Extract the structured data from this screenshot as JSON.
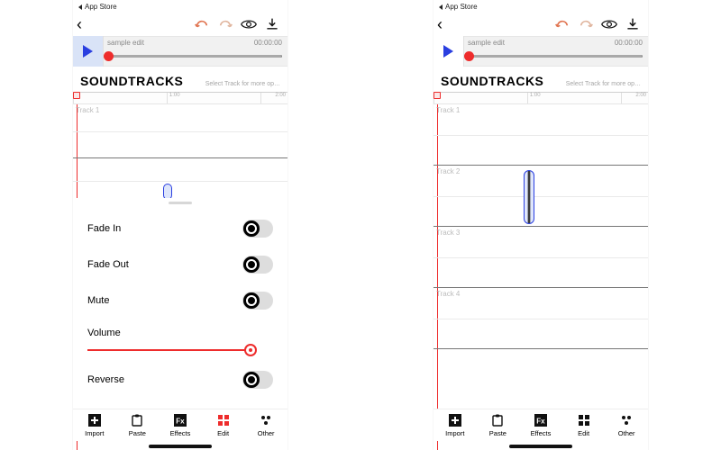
{
  "status": {
    "back_to_app": "App Store"
  },
  "toolbar": {
    "undo": "undo",
    "redo": "redo",
    "preview": "preview",
    "download": "download"
  },
  "transport": {
    "title": "sample edit",
    "time": "00:00:00"
  },
  "section": {
    "title": "SOUNDTRACKS",
    "hint": "Select Track for more op…"
  },
  "ruler": {
    "marks": [
      "",
      "1:00",
      "2:00"
    ]
  },
  "tracks": {
    "t1": "Track 1",
    "t2": "Track 2",
    "t3": "Track 3",
    "t4": "Track 4"
  },
  "sheet": {
    "fade_in": "Fade In",
    "fade_out": "Fade Out",
    "mute": "Mute",
    "volume": "Volume",
    "reverse": "Reverse"
  },
  "tabs": {
    "import": "Import",
    "paste": "Paste",
    "effects": "Effects",
    "edit": "Edit",
    "other": "Other"
  }
}
